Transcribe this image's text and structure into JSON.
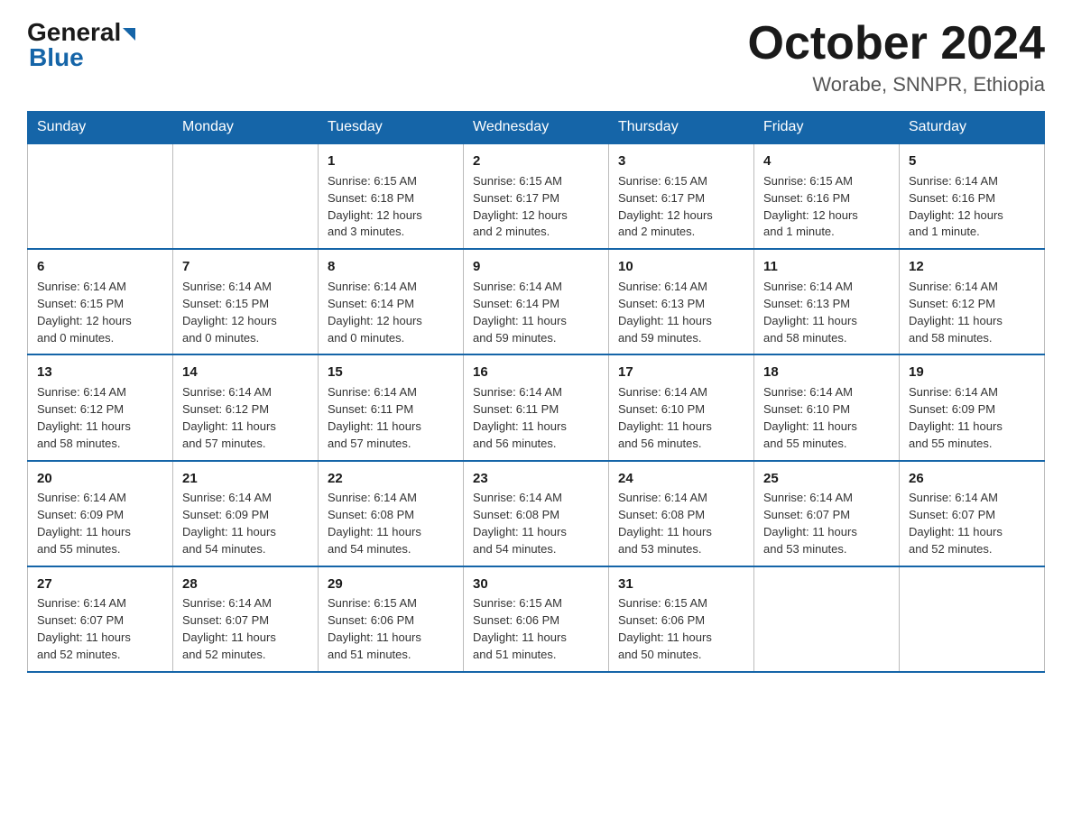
{
  "logo": {
    "general": "General",
    "blue": "Blue"
  },
  "title": "October 2024",
  "location": "Worabe, SNNPR, Ethiopia",
  "days_header": [
    "Sunday",
    "Monday",
    "Tuesday",
    "Wednesday",
    "Thursday",
    "Friday",
    "Saturday"
  ],
  "weeks": [
    [
      {
        "day": "",
        "info": ""
      },
      {
        "day": "",
        "info": ""
      },
      {
        "day": "1",
        "info": "Sunrise: 6:15 AM\nSunset: 6:18 PM\nDaylight: 12 hours\nand 3 minutes."
      },
      {
        "day": "2",
        "info": "Sunrise: 6:15 AM\nSunset: 6:17 PM\nDaylight: 12 hours\nand 2 minutes."
      },
      {
        "day": "3",
        "info": "Sunrise: 6:15 AM\nSunset: 6:17 PM\nDaylight: 12 hours\nand 2 minutes."
      },
      {
        "day": "4",
        "info": "Sunrise: 6:15 AM\nSunset: 6:16 PM\nDaylight: 12 hours\nand 1 minute."
      },
      {
        "day": "5",
        "info": "Sunrise: 6:14 AM\nSunset: 6:16 PM\nDaylight: 12 hours\nand 1 minute."
      }
    ],
    [
      {
        "day": "6",
        "info": "Sunrise: 6:14 AM\nSunset: 6:15 PM\nDaylight: 12 hours\nand 0 minutes."
      },
      {
        "day": "7",
        "info": "Sunrise: 6:14 AM\nSunset: 6:15 PM\nDaylight: 12 hours\nand 0 minutes."
      },
      {
        "day": "8",
        "info": "Sunrise: 6:14 AM\nSunset: 6:14 PM\nDaylight: 12 hours\nand 0 minutes."
      },
      {
        "day": "9",
        "info": "Sunrise: 6:14 AM\nSunset: 6:14 PM\nDaylight: 11 hours\nand 59 minutes."
      },
      {
        "day": "10",
        "info": "Sunrise: 6:14 AM\nSunset: 6:13 PM\nDaylight: 11 hours\nand 59 minutes."
      },
      {
        "day": "11",
        "info": "Sunrise: 6:14 AM\nSunset: 6:13 PM\nDaylight: 11 hours\nand 58 minutes."
      },
      {
        "day": "12",
        "info": "Sunrise: 6:14 AM\nSunset: 6:12 PM\nDaylight: 11 hours\nand 58 minutes."
      }
    ],
    [
      {
        "day": "13",
        "info": "Sunrise: 6:14 AM\nSunset: 6:12 PM\nDaylight: 11 hours\nand 58 minutes."
      },
      {
        "day": "14",
        "info": "Sunrise: 6:14 AM\nSunset: 6:12 PM\nDaylight: 11 hours\nand 57 minutes."
      },
      {
        "day": "15",
        "info": "Sunrise: 6:14 AM\nSunset: 6:11 PM\nDaylight: 11 hours\nand 57 minutes."
      },
      {
        "day": "16",
        "info": "Sunrise: 6:14 AM\nSunset: 6:11 PM\nDaylight: 11 hours\nand 56 minutes."
      },
      {
        "day": "17",
        "info": "Sunrise: 6:14 AM\nSunset: 6:10 PM\nDaylight: 11 hours\nand 56 minutes."
      },
      {
        "day": "18",
        "info": "Sunrise: 6:14 AM\nSunset: 6:10 PM\nDaylight: 11 hours\nand 55 minutes."
      },
      {
        "day": "19",
        "info": "Sunrise: 6:14 AM\nSunset: 6:09 PM\nDaylight: 11 hours\nand 55 minutes."
      }
    ],
    [
      {
        "day": "20",
        "info": "Sunrise: 6:14 AM\nSunset: 6:09 PM\nDaylight: 11 hours\nand 55 minutes."
      },
      {
        "day": "21",
        "info": "Sunrise: 6:14 AM\nSunset: 6:09 PM\nDaylight: 11 hours\nand 54 minutes."
      },
      {
        "day": "22",
        "info": "Sunrise: 6:14 AM\nSunset: 6:08 PM\nDaylight: 11 hours\nand 54 minutes."
      },
      {
        "day": "23",
        "info": "Sunrise: 6:14 AM\nSunset: 6:08 PM\nDaylight: 11 hours\nand 54 minutes."
      },
      {
        "day": "24",
        "info": "Sunrise: 6:14 AM\nSunset: 6:08 PM\nDaylight: 11 hours\nand 53 minutes."
      },
      {
        "day": "25",
        "info": "Sunrise: 6:14 AM\nSunset: 6:07 PM\nDaylight: 11 hours\nand 53 minutes."
      },
      {
        "day": "26",
        "info": "Sunrise: 6:14 AM\nSunset: 6:07 PM\nDaylight: 11 hours\nand 52 minutes."
      }
    ],
    [
      {
        "day": "27",
        "info": "Sunrise: 6:14 AM\nSunset: 6:07 PM\nDaylight: 11 hours\nand 52 minutes."
      },
      {
        "day": "28",
        "info": "Sunrise: 6:14 AM\nSunset: 6:07 PM\nDaylight: 11 hours\nand 52 minutes."
      },
      {
        "day": "29",
        "info": "Sunrise: 6:15 AM\nSunset: 6:06 PM\nDaylight: 11 hours\nand 51 minutes."
      },
      {
        "day": "30",
        "info": "Sunrise: 6:15 AM\nSunset: 6:06 PM\nDaylight: 11 hours\nand 51 minutes."
      },
      {
        "day": "31",
        "info": "Sunrise: 6:15 AM\nSunset: 6:06 PM\nDaylight: 11 hours\nand 50 minutes."
      },
      {
        "day": "",
        "info": ""
      },
      {
        "day": "",
        "info": ""
      }
    ]
  ]
}
